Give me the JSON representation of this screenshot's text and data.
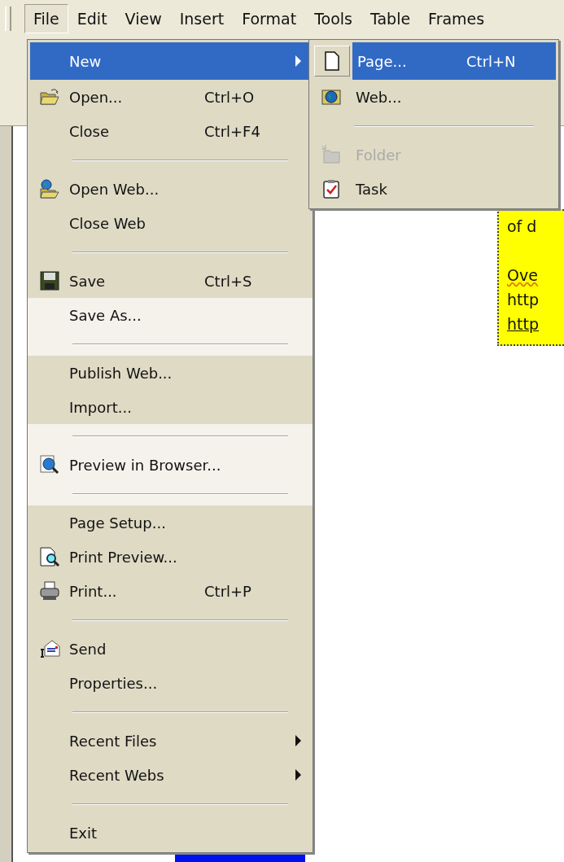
{
  "menu_bar": [
    {
      "label": "File",
      "selected": true
    },
    {
      "label": "Edit",
      "selected": false
    },
    {
      "label": "View",
      "selected": false
    },
    {
      "label": "Insert",
      "selected": false
    },
    {
      "label": "Format",
      "selected": false
    },
    {
      "label": "Tools",
      "selected": false
    },
    {
      "label": "Table",
      "selected": false
    },
    {
      "label": "Frames",
      "selected": false
    }
  ],
  "file_menu": [
    {
      "kind": "item",
      "label": "New",
      "submenu": true,
      "selected": true,
      "rarely_used": false
    },
    {
      "kind": "item",
      "label": "Open...",
      "shortcut": "Ctrl+O",
      "submenu": false,
      "selected": false,
      "rarely_used": false
    },
    {
      "kind": "item",
      "label": "Close",
      "shortcut": "Ctrl+F4",
      "submenu": false,
      "selected": false,
      "rarely_used": false
    },
    {
      "kind": "separator",
      "rarely_used": false
    },
    {
      "kind": "item",
      "label": "Open Web...",
      "submenu": false,
      "selected": false,
      "rarely_used": false
    },
    {
      "kind": "item",
      "label": "Close Web",
      "submenu": false,
      "selected": false,
      "rarely_used": false
    },
    {
      "kind": "separator",
      "rarely_used": false
    },
    {
      "kind": "item",
      "label": "Save",
      "shortcut": "Ctrl+S",
      "submenu": false,
      "selected": false,
      "rarely_used": false
    },
    {
      "kind": "item",
      "label": "Save As...",
      "submenu": false,
      "selected": false,
      "rarely_used": true
    },
    {
      "kind": "separator",
      "rarely_used": true
    },
    {
      "kind": "item",
      "label": "Publish Web...",
      "submenu": false,
      "selected": false,
      "rarely_used": false
    },
    {
      "kind": "item",
      "label": "Import...",
      "submenu": false,
      "selected": false,
      "rarely_used": false
    },
    {
      "kind": "separator",
      "rarely_used": true
    },
    {
      "kind": "item",
      "label": "Preview in Browser...",
      "submenu": false,
      "selected": false,
      "rarely_used": true
    },
    {
      "kind": "separator",
      "rarely_used": true
    },
    {
      "kind": "item",
      "label": "Page Setup...",
      "submenu": false,
      "selected": false,
      "rarely_used": false
    },
    {
      "kind": "item",
      "label": "Print Preview...",
      "submenu": false,
      "selected": false,
      "rarely_used": false
    },
    {
      "kind": "item",
      "label": "Print...",
      "shortcut": "Ctrl+P",
      "submenu": false,
      "selected": false,
      "rarely_used": false
    },
    {
      "kind": "separator",
      "rarely_used": false
    },
    {
      "kind": "item",
      "label": "Send",
      "submenu": false,
      "selected": false,
      "rarely_used": false
    },
    {
      "kind": "item",
      "label": "Properties...",
      "submenu": false,
      "selected": false,
      "rarely_used": false
    },
    {
      "kind": "separator",
      "rarely_used": false
    },
    {
      "kind": "item",
      "label": "Recent Files",
      "submenu": true,
      "selected": false,
      "rarely_used": false
    },
    {
      "kind": "item",
      "label": "Recent Webs",
      "submenu": true,
      "selected": false,
      "rarely_used": false
    },
    {
      "kind": "separator",
      "rarely_used": false
    },
    {
      "kind": "item",
      "label": "Exit",
      "submenu": false,
      "selected": false,
      "rarely_used": false
    }
  ],
  "new_submenu": [
    {
      "kind": "item",
      "label": "Page...",
      "shortcut": "Ctrl+N",
      "selected": true,
      "disabled": false
    },
    {
      "kind": "item",
      "label": "Web...",
      "selected": false,
      "disabled": false
    },
    {
      "kind": "separator"
    },
    {
      "kind": "item",
      "label": "Folder",
      "selected": false,
      "disabled": true
    },
    {
      "kind": "item",
      "label": "Task",
      "selected": false,
      "disabled": false
    }
  ],
  "document_note": {
    "lines": [
      {
        "kind": "text",
        "text": "of d"
      },
      {
        "kind": "blank"
      },
      {
        "kind": "misspelled",
        "text": "Ove"
      },
      {
        "kind": "text",
        "text": "http"
      },
      {
        "kind": "link",
        "text": "http"
      }
    ]
  }
}
